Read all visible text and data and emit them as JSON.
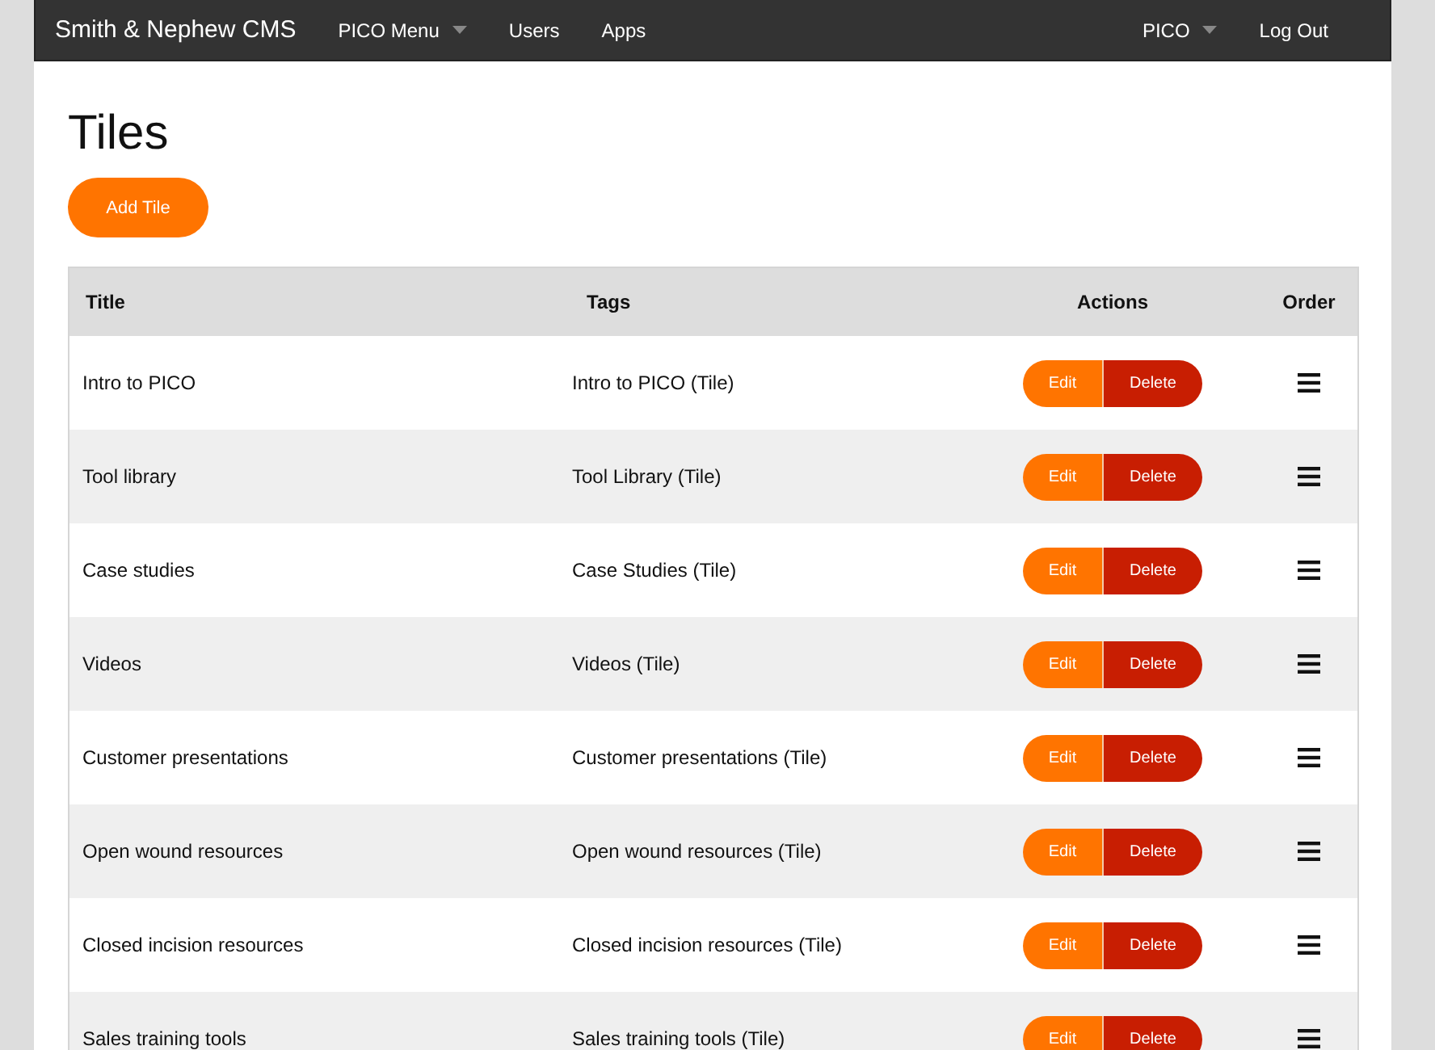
{
  "navbar": {
    "brand": "Smith & Nephew CMS",
    "items": [
      {
        "label": "PICO Menu",
        "dropdown": true
      },
      {
        "label": "Users",
        "dropdown": false
      },
      {
        "label": "Apps",
        "dropdown": false
      }
    ],
    "right_items": [
      {
        "label": "PICO",
        "dropdown": true
      },
      {
        "label": "Log Out",
        "dropdown": false
      }
    ]
  },
  "page": {
    "title": "Tiles",
    "add_button": "Add Tile"
  },
  "table": {
    "columns": [
      "Title",
      "Tags",
      "Actions",
      "Order"
    ],
    "rows": [
      {
        "title": "Intro to PICO",
        "tags": "Intro to PICO (Tile)",
        "edit": "Edit",
        "delete": "Delete"
      },
      {
        "title": "Tool library",
        "tags": "Tool Library (Tile)",
        "edit": "Edit",
        "delete": "Delete"
      },
      {
        "title": "Case studies",
        "tags": "Case Studies (Tile)",
        "edit": "Edit",
        "delete": "Delete"
      },
      {
        "title": "Videos",
        "tags": "Videos (Tile)",
        "edit": "Edit",
        "delete": "Delete"
      },
      {
        "title": "Customer presentations",
        "tags": "Customer presentations (Tile)",
        "edit": "Edit",
        "delete": "Delete"
      },
      {
        "title": "Open wound resources",
        "tags": "Open wound resources (Tile)",
        "edit": "Edit",
        "delete": "Delete"
      },
      {
        "title": "Closed incision resources",
        "tags": "Closed incision resources (Tile)",
        "edit": "Edit",
        "delete": "Delete"
      },
      {
        "title": "Sales training tools",
        "tags": "Sales training tools (Tile)",
        "edit": "Edit",
        "delete": "Delete"
      }
    ]
  }
}
